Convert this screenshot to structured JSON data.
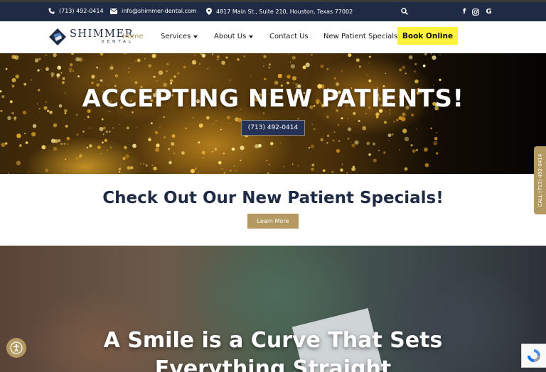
{
  "topbar": {
    "phone": "(713) 492-0414",
    "email": "info@shimmer-dental.com",
    "address": "4817 Main St., Suite 210, Houston, Texas 77002",
    "social": [
      "facebook-icon",
      "instagram-icon",
      "google-icon"
    ]
  },
  "logo": {
    "name": "SHIMMER",
    "tagline": "DENTAL"
  },
  "nav": {
    "items": [
      {
        "label": "Home",
        "active": true
      },
      {
        "label": "Services",
        "dropdown": true
      },
      {
        "label": "About Us",
        "dropdown": true
      },
      {
        "label": "Contact Us"
      },
      {
        "label": "New Patient Specials"
      }
    ],
    "cta": "Book Online"
  },
  "hero": {
    "title": "ACCEPTING NEW PATIENTS!",
    "phone_button": "(713) 492-0414"
  },
  "specials": {
    "heading": "Check Out Our New Patient Specials!",
    "button": "Learn More"
  },
  "photo_section": {
    "line1": "A Smile is a Curve That Sets",
    "line2": "Everything Straight"
  },
  "floating": {
    "call_tab": "CALL (713) 492-0414"
  },
  "colors": {
    "navy": "#1f2a44",
    "gold": "#b49a62",
    "cta_yellow": "#fff23a"
  }
}
